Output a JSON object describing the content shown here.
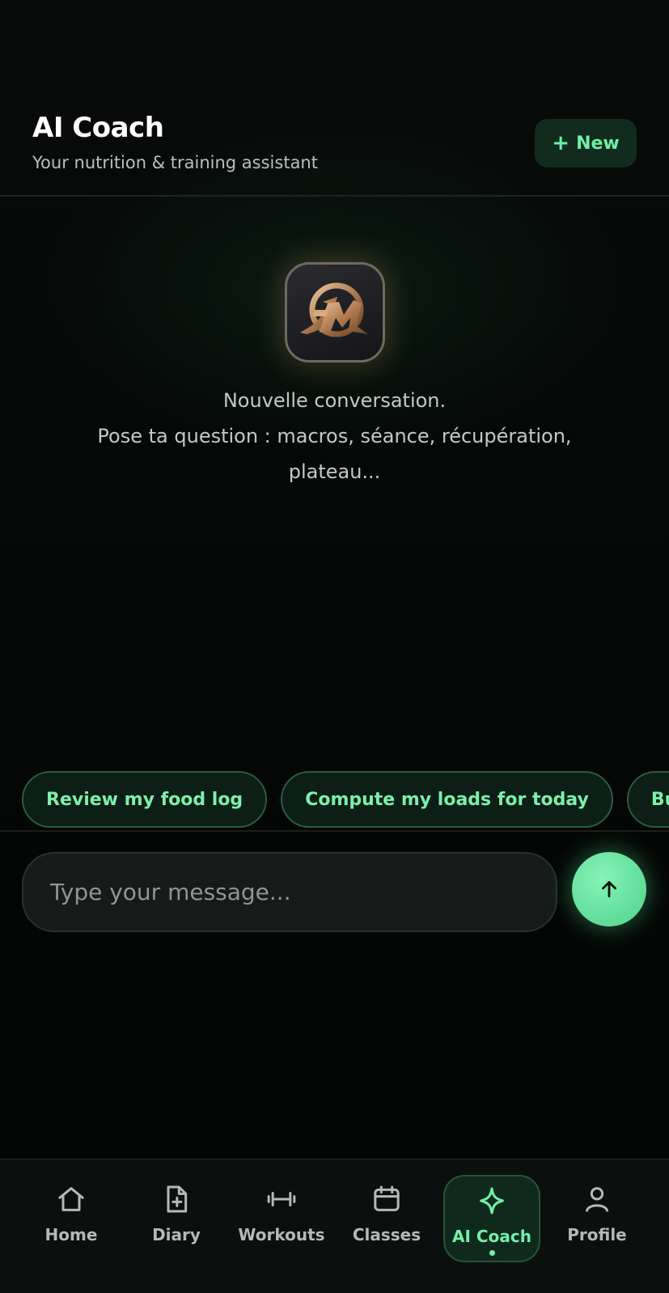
{
  "header": {
    "title": "AI Coach",
    "subtitle": "Your nutrition & training assistant",
    "new_button": {
      "icon": "plus-icon",
      "label": "New"
    }
  },
  "empty_state": {
    "logo": "DM-logo",
    "line1": "Nouvelle conversation.",
    "line2": "Pose ta question : macros, séance, récupération, plateau..."
  },
  "suggestions": [
    {
      "label": "Review my food log"
    },
    {
      "label": "Compute my loads for today"
    },
    {
      "label": "Build me"
    }
  ],
  "composer": {
    "placeholder": "Type your message...",
    "send_icon": "arrow-up-icon"
  },
  "nav": {
    "items": [
      {
        "label": "Home",
        "icon": "home-icon",
        "active": false
      },
      {
        "label": "Diary",
        "icon": "diary-icon",
        "active": false
      },
      {
        "label": "Workouts",
        "icon": "dumbbell-icon",
        "active": false
      },
      {
        "label": "Classes",
        "icon": "calendar-icon",
        "active": false
      },
      {
        "label": "AI Coach",
        "icon": "sparkle-icon",
        "active": true
      },
      {
        "label": "Profile",
        "icon": "user-icon",
        "active": false
      }
    ]
  },
  "colors": {
    "accent": "#74f0a8",
    "background": "#040605",
    "chip_border": "#2a5c40",
    "send_button": "#5fdc97"
  }
}
